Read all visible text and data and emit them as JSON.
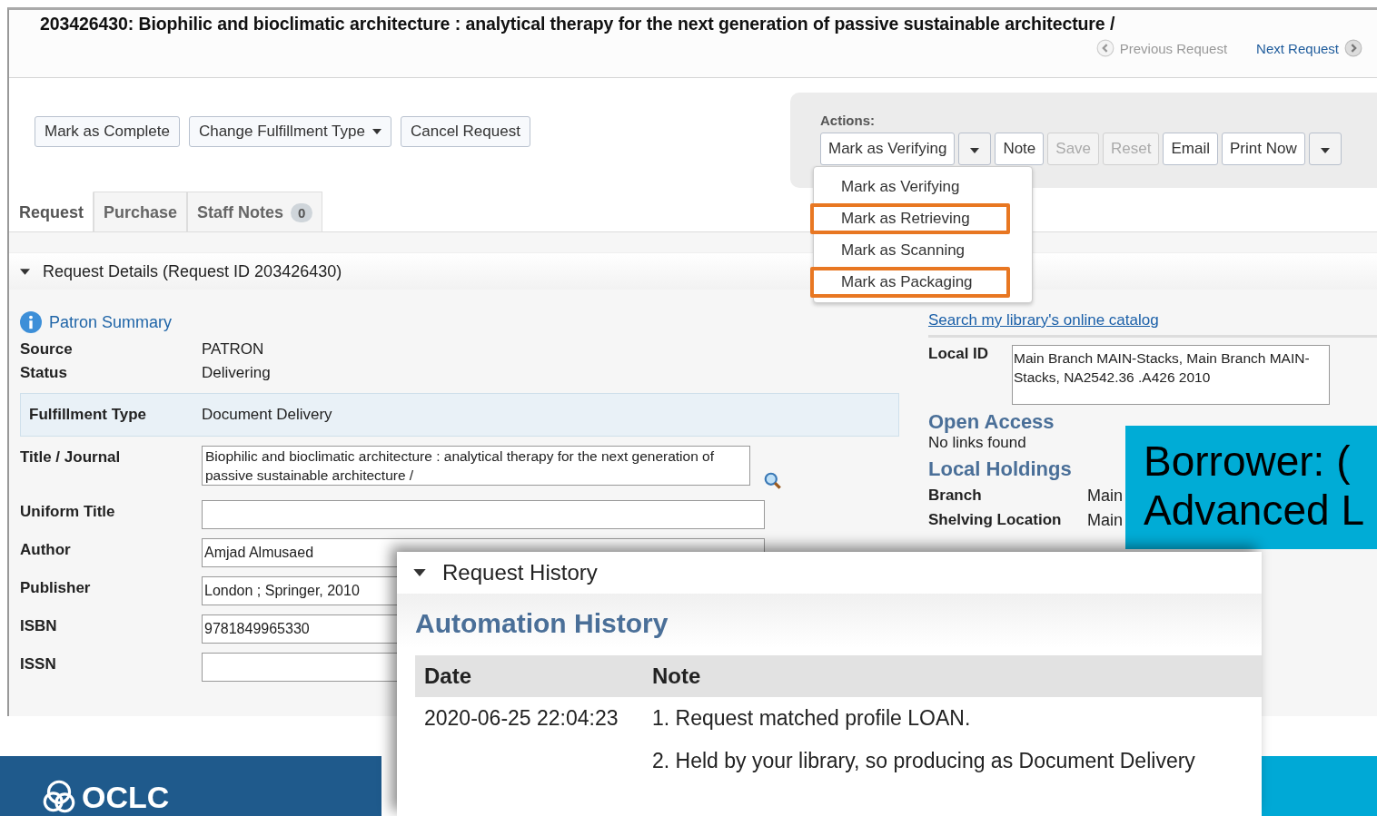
{
  "header": {
    "title": "203426430: Biophilic and bioclimatic architecture : analytical therapy for the next generation of passive sustainable architecture /",
    "previous": {
      "label": "Previous Request",
      "disabled": true
    },
    "next": {
      "label": "Next Request",
      "disabled": false
    }
  },
  "buttons": [
    {
      "label": "Mark as Complete",
      "caret": false
    },
    {
      "label": "Change Fulfillment Type",
      "caret": true
    },
    {
      "label": "Cancel Request",
      "caret": false
    }
  ],
  "actions": {
    "label": "Actions:",
    "status_button": "Mark as Verifying",
    "buttons": [
      {
        "label": "Note",
        "disabled": false
      },
      {
        "label": "Save",
        "disabled": true
      },
      {
        "label": "Reset",
        "disabled": true
      },
      {
        "label": "Email",
        "disabled": false
      }
    ],
    "print_button": "Print Now"
  },
  "status_menu": [
    {
      "label": "Mark as Verifying",
      "highlighted": false
    },
    {
      "label": "Mark as Retrieving",
      "highlighted": true
    },
    {
      "label": "Mark as Scanning",
      "highlighted": false
    },
    {
      "label": "Mark as Packaging",
      "highlighted": true
    }
  ],
  "tabs": [
    {
      "label": "Request",
      "selected": true
    },
    {
      "label": "Purchase",
      "selected": false
    },
    {
      "label": "Staff Notes",
      "selected": false,
      "badge": "0"
    }
  ],
  "section": "Request Details (Request ID 203426430)",
  "patron_summary": "Patron Summary",
  "summary": [
    {
      "label": "Source",
      "value": "PATRON"
    },
    {
      "label": "Status",
      "value": "Delivering"
    }
  ],
  "fulfillment": {
    "label": "Fulfillment Type",
    "value": "Document Delivery"
  },
  "fields": [
    {
      "label": "Title / Journal",
      "kind": "textarea",
      "value": "Biophilic and bioclimatic architecture : analytical therapy for the next generation of passive sustainable architecture /"
    },
    {
      "label": "Uniform Title",
      "kind": "input"
    },
    {
      "label": "Author",
      "kind": "input",
      "value": "Amjad Almusaed"
    },
    {
      "label": "Publisher",
      "kind": "input",
      "value": "London ; Springer, 2010"
    },
    {
      "label": "ISBN",
      "kind": "input",
      "value": "9781849965330"
    },
    {
      "label": "ISSN",
      "kind": "input"
    }
  ],
  "right": {
    "catalog_link": "Search my library's online catalog",
    "local_id": {
      "label": "Local ID",
      "value": "Main Branch MAIN-Stacks, Main Branch MAIN-Stacks, NA2542.36 .A426 2010"
    },
    "open_access": {
      "heading": "Open Access",
      "text": "No links found"
    },
    "local_holdings": {
      "heading": "Local Holdings",
      "rows": [
        {
          "label": "Branch",
          "value": "Main"
        },
        {
          "label": "Shelving Location",
          "value": "Main"
        }
      ]
    }
  },
  "callout": {
    "lines": [
      "Borrower: (",
      "Advanced L"
    ]
  },
  "history": {
    "title": "Request History",
    "heading": "Automation History",
    "columns": [
      "Date",
      "Note"
    ],
    "rows": [
      {
        "date": "2020-06-25 22:04:23",
        "notes": [
          "1. Request matched profile LOAN.",
          "2. Held by your library, so producing as Document Delivery"
        ]
      }
    ]
  },
  "footer": {
    "logo": "OCLC"
  }
}
